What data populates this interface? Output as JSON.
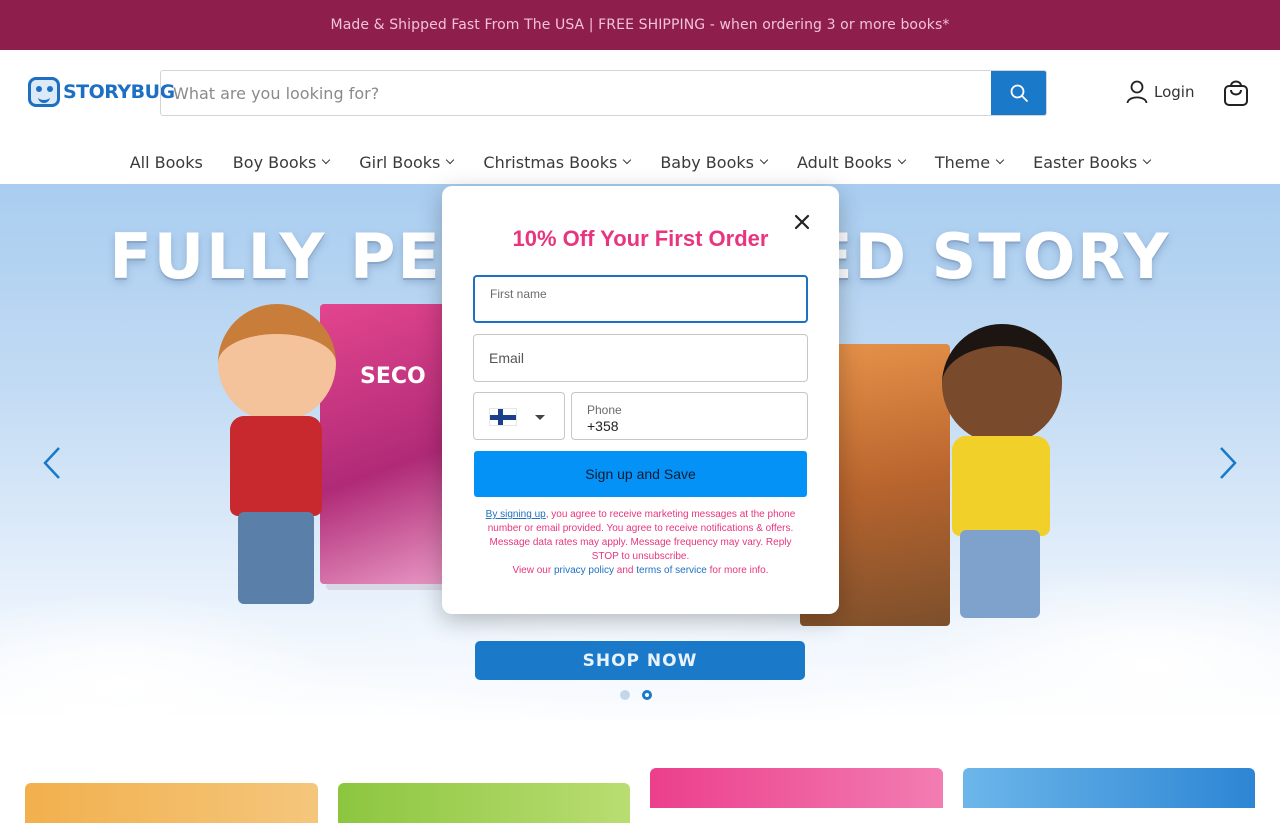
{
  "announcement": "Made & Shipped Fast From The USA | FREE SHIPPING - when ordering 3 or more books*",
  "header": {
    "logo_text": "STORYBUG",
    "search_placeholder": "What are you looking for?",
    "login_label": "Login"
  },
  "nav": {
    "items": [
      {
        "label": "All Books",
        "dropdown": false
      },
      {
        "label": "Boy Books",
        "dropdown": true
      },
      {
        "label": "Girl Books",
        "dropdown": true
      },
      {
        "label": "Christmas Books",
        "dropdown": true
      },
      {
        "label": "Baby Books",
        "dropdown": true
      },
      {
        "label": "Adult Books",
        "dropdown": true
      },
      {
        "label": "Theme",
        "dropdown": true
      },
      {
        "label": "Easter Books",
        "dropdown": true
      }
    ]
  },
  "hero": {
    "title": "FULLY PERSONALIZED STORY BOOKS!",
    "book_left_label": "SECO",
    "cta": "SHOP NOW",
    "slides": 2,
    "active_slide": 2
  },
  "modal": {
    "title": "10% Off Your First Order",
    "first_name_label": "First name",
    "email_placeholder": "Email",
    "phone_label": "Phone",
    "phone_value": "+358",
    "country_flag": "finland-flag",
    "submit_label": "Sign up and Save",
    "legal_link": "By signing up",
    "legal_text_1": ", you agree to receive marketing messages at the phone number or email provided. You agree to receive notifications & offers. Message data rates may apply. Message frequency may vary. Reply STOP to unsubscribe.",
    "legal_view": "View our ",
    "privacy_link": "privacy policy",
    "and": " and ",
    "terms_link": "terms of service",
    "more_info": " for more info."
  },
  "colors": {
    "announcement_bg": "#8e1f4c",
    "brand_blue": "#1a79c9",
    "modal_accent": "#e8357f",
    "signup_button": "#0592f6"
  }
}
